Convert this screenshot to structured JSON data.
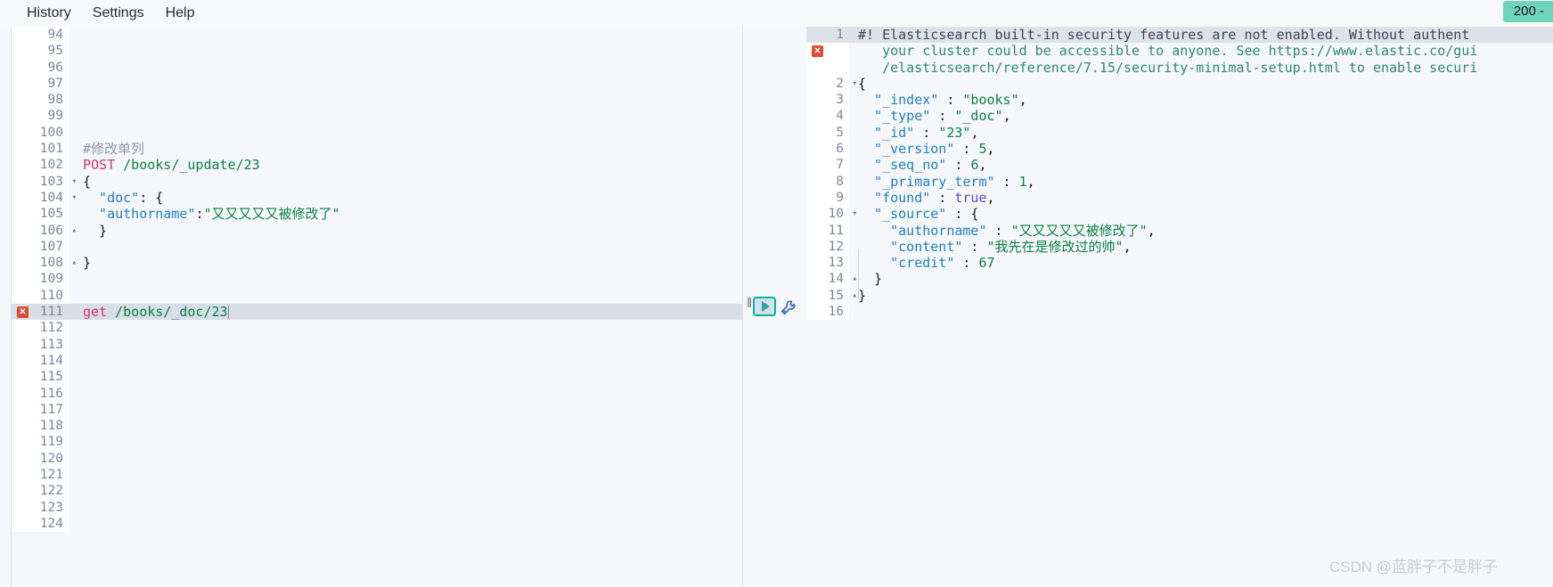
{
  "menu": {
    "items": [
      {
        "label": "History",
        "name": "menu-history"
      },
      {
        "label": "Settings",
        "name": "menu-settings"
      },
      {
        "label": "Help",
        "name": "menu-help"
      }
    ]
  },
  "status": {
    "text": "200 -"
  },
  "watermark": {
    "text": "CSDN @蓝胖子不是胖子"
  },
  "colors": {
    "accent": "#00b3a4",
    "status_badge_bg": "#6fd3bb",
    "error_marker": "#e04a2f",
    "active_line_left": "#d8dee7",
    "active_line_right": "#dde1ea",
    "string": "#0b8043",
    "key": "#1f7fbf",
    "method": "#d6316b",
    "bool": "#5b49d8",
    "comment": "#8d99a8"
  },
  "editor": {
    "name": "request-editor",
    "active_line": 111,
    "cursor_line": 111,
    "lines": [
      {
        "num": 94,
        "fold": "",
        "error": false,
        "tokens": []
      },
      {
        "num": 95,
        "fold": "",
        "error": false,
        "tokens": []
      },
      {
        "num": 96,
        "fold": "",
        "error": false,
        "tokens": []
      },
      {
        "num": 97,
        "fold": "",
        "error": false,
        "tokens": []
      },
      {
        "num": 98,
        "fold": "",
        "error": false,
        "tokens": []
      },
      {
        "num": 99,
        "fold": "",
        "error": false,
        "tokens": []
      },
      {
        "num": 100,
        "fold": "",
        "error": false,
        "tokens": []
      },
      {
        "num": 101,
        "fold": "",
        "error": false,
        "tokens": [
          {
            "c": "comment",
            "t": "#修改单列"
          }
        ]
      },
      {
        "num": 102,
        "fold": "",
        "error": false,
        "tokens": [
          {
            "c": "method",
            "t": "POST"
          },
          {
            "c": "plain",
            "t": " "
          },
          {
            "c": "url",
            "t": "/books/_update/23"
          }
        ]
      },
      {
        "num": 103,
        "fold": "open",
        "error": false,
        "tokens": [
          {
            "c": "punct",
            "t": "{"
          }
        ]
      },
      {
        "num": 104,
        "fold": "open",
        "error": false,
        "tokens": [
          {
            "c": "key",
            "t": "  \"doc\""
          },
          {
            "c": "punct",
            "t": ": {"
          }
        ]
      },
      {
        "num": 105,
        "fold": "",
        "error": false,
        "tokens": [
          {
            "c": "key",
            "t": "  \"authorname\""
          },
          {
            "c": "punct",
            "t": ":"
          },
          {
            "c": "string",
            "t": "\"又又又又又被修改了\""
          }
        ]
      },
      {
        "num": 106,
        "fold": "close",
        "error": false,
        "tokens": [
          {
            "c": "punct",
            "t": "  }"
          }
        ]
      },
      {
        "num": 107,
        "fold": "",
        "error": false,
        "tokens": []
      },
      {
        "num": 108,
        "fold": "close",
        "error": false,
        "tokens": [
          {
            "c": "punct",
            "t": "}"
          }
        ]
      },
      {
        "num": 109,
        "fold": "",
        "error": false,
        "tokens": []
      },
      {
        "num": 110,
        "fold": "",
        "error": false,
        "tokens": []
      },
      {
        "num": 111,
        "fold": "",
        "error": true,
        "active": true,
        "cursor": true,
        "tokens": [
          {
            "c": "method",
            "t": "get"
          },
          {
            "c": "plain",
            "t": " "
          },
          {
            "c": "url",
            "t": "/books/_doc/23"
          }
        ]
      },
      {
        "num": 112,
        "fold": "",
        "error": false,
        "tokens": []
      },
      {
        "num": 113,
        "fold": "",
        "error": false,
        "tokens": []
      },
      {
        "num": 114,
        "fold": "",
        "error": false,
        "tokens": []
      },
      {
        "num": 115,
        "fold": "",
        "error": false,
        "tokens": []
      },
      {
        "num": 116,
        "fold": "",
        "error": false,
        "tokens": []
      },
      {
        "num": 117,
        "fold": "",
        "error": false,
        "tokens": []
      },
      {
        "num": 118,
        "fold": "",
        "error": false,
        "tokens": []
      },
      {
        "num": 119,
        "fold": "",
        "error": false,
        "tokens": []
      },
      {
        "num": 120,
        "fold": "",
        "error": false,
        "tokens": []
      },
      {
        "num": 121,
        "fold": "",
        "error": false,
        "tokens": []
      },
      {
        "num": 122,
        "fold": "",
        "error": false,
        "tokens": []
      },
      {
        "num": 123,
        "fold": "",
        "error": false,
        "tokens": []
      },
      {
        "num": 124,
        "fold": "",
        "error": false,
        "tokens": []
      }
    ],
    "actions": {
      "play_name": "run-request-button",
      "wrench_name": "request-options-wrench-icon"
    }
  },
  "response": {
    "name": "response-viewer",
    "lines": [
      {
        "num": 1,
        "fold": "",
        "error": false,
        "active": true,
        "tokens": [
          {
            "c": "warn",
            "t": "#! Elasticsearch built-in security features are not enabled. Without authent"
          }
        ]
      },
      {
        "num": "",
        "fold": "",
        "error": true,
        "active": false,
        "tokens": [
          {
            "c": "warnlink",
            "t": "   your cluster could be accessible to anyone. See https://www.elastic.co/gui"
          }
        ]
      },
      {
        "num": "",
        "fold": "",
        "error": false,
        "active": false,
        "tokens": [
          {
            "c": "warnlink",
            "t": "   /elasticsearch/reference/7.15/security-minimal-setup.html to enable securi"
          }
        ]
      },
      {
        "num": 2,
        "fold": "open",
        "error": false,
        "active": false,
        "tokens": [
          {
            "c": "punct",
            "t": "{"
          }
        ]
      },
      {
        "num": 3,
        "fold": "",
        "error": false,
        "active": false,
        "tokens": [
          {
            "c": "key",
            "t": "  \"_index\""
          },
          {
            "c": "punct",
            "t": " : "
          },
          {
            "c": "string",
            "t": "\"books\""
          },
          {
            "c": "punct",
            "t": ","
          }
        ]
      },
      {
        "num": 4,
        "fold": "",
        "error": false,
        "active": false,
        "tokens": [
          {
            "c": "key",
            "t": "  \"_type\""
          },
          {
            "c": "punct",
            "t": " : "
          },
          {
            "c": "string",
            "t": "\"_doc\""
          },
          {
            "c": "punct",
            "t": ","
          }
        ]
      },
      {
        "num": 5,
        "fold": "",
        "error": false,
        "active": false,
        "tokens": [
          {
            "c": "key",
            "t": "  \"_id\""
          },
          {
            "c": "punct",
            "t": " : "
          },
          {
            "c": "string",
            "t": "\"23\""
          },
          {
            "c": "punct",
            "t": ","
          }
        ]
      },
      {
        "num": 6,
        "fold": "",
        "error": false,
        "active": false,
        "tokens": [
          {
            "c": "key",
            "t": "  \"_version\""
          },
          {
            "c": "punct",
            "t": " : "
          },
          {
            "c": "num",
            "t": "5"
          },
          {
            "c": "punct",
            "t": ","
          }
        ]
      },
      {
        "num": 7,
        "fold": "",
        "error": false,
        "active": false,
        "tokens": [
          {
            "c": "key",
            "t": "  \"_seq_no\""
          },
          {
            "c": "punct",
            "t": " : "
          },
          {
            "c": "num",
            "t": "6"
          },
          {
            "c": "punct",
            "t": ","
          }
        ]
      },
      {
        "num": 8,
        "fold": "",
        "error": false,
        "active": false,
        "tokens": [
          {
            "c": "key",
            "t": "  \"_primary_term\""
          },
          {
            "c": "punct",
            "t": " : "
          },
          {
            "c": "num",
            "t": "1"
          },
          {
            "c": "punct",
            "t": ","
          }
        ]
      },
      {
        "num": 9,
        "fold": "",
        "error": false,
        "active": false,
        "tokens": [
          {
            "c": "key",
            "t": "  \"found\""
          },
          {
            "c": "punct",
            "t": " : "
          },
          {
            "c": "bool",
            "t": "true"
          },
          {
            "c": "punct",
            "t": ","
          }
        ]
      },
      {
        "num": 10,
        "fold": "open",
        "error": false,
        "active": false,
        "tokens": [
          {
            "c": "key",
            "t": "  \"_source\""
          },
          {
            "c": "punct",
            "t": " : {"
          }
        ]
      },
      {
        "num": 11,
        "fold": "",
        "error": false,
        "active": false,
        "tokens": [
          {
            "c": "key",
            "t": "    \"authorname\""
          },
          {
            "c": "punct",
            "t": " : "
          },
          {
            "c": "string",
            "t": "\"又又又又又被修改了\""
          },
          {
            "c": "punct",
            "t": ","
          }
        ]
      },
      {
        "num": 12,
        "fold": "",
        "error": false,
        "active": false,
        "tokens": [
          {
            "c": "key",
            "t": "    \"content\""
          },
          {
            "c": "punct",
            "t": " : "
          },
          {
            "c": "string",
            "t": "\"我先在是修改过的帅\""
          },
          {
            "c": "punct",
            "t": ","
          }
        ]
      },
      {
        "num": 13,
        "fold": "",
        "error": false,
        "active": false,
        "tokens": [
          {
            "c": "key",
            "t": "    \"credit\""
          },
          {
            "c": "punct",
            "t": " : "
          },
          {
            "c": "num",
            "t": "67"
          }
        ]
      },
      {
        "num": 14,
        "fold": "close",
        "error": false,
        "active": false,
        "tokens": [
          {
            "c": "punct",
            "t": "  }"
          }
        ]
      },
      {
        "num": 15,
        "fold": "close",
        "error": false,
        "active": false,
        "tokens": [
          {
            "c": "punct",
            "t": "}"
          }
        ]
      },
      {
        "num": 16,
        "fold": "",
        "error": false,
        "active": false,
        "tokens": []
      }
    ]
  }
}
